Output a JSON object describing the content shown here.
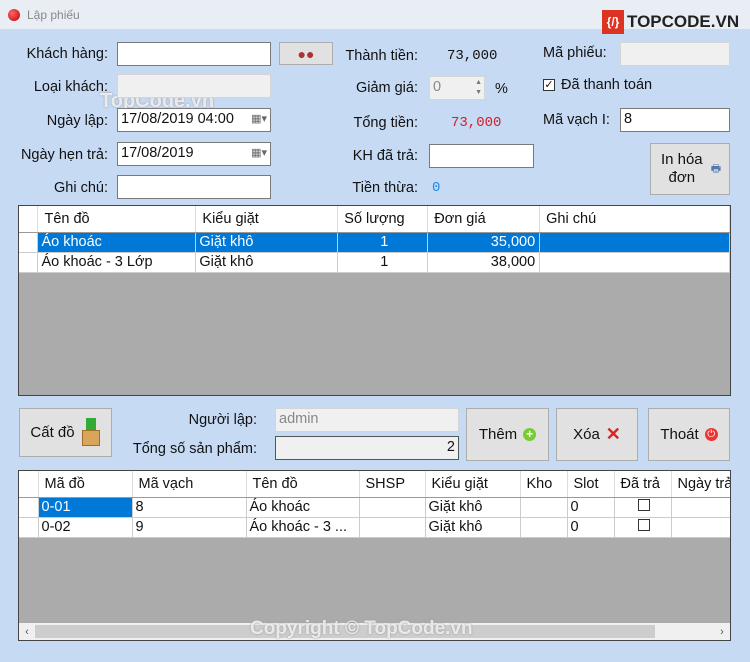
{
  "window": {
    "title": "Lập phiếu",
    "logo": "TOPCODE.VN",
    "watermark": "TopCode.vn",
    "copyright": "Copyright © TopCode.vn"
  },
  "form": {
    "khach_hang_label": "Khách hàng:",
    "khach_hang_value": "",
    "loai_khach_label": "Loại khách:",
    "loai_khach_value": "",
    "ngay_lap_label": "Ngày lập:",
    "ngay_lap_value": "17/08/2019 04:00",
    "ngay_hen_tra_label": "Ngày hẹn trả:",
    "ngay_hen_tra_value": "17/08/2019",
    "ghi_chu_label": "Ghi chú:",
    "ghi_chu_value": "",
    "thanh_tien_label": "Thành tiền:",
    "thanh_tien_value": "73,000",
    "giam_gia_label": "Giảm giá:",
    "giam_gia_value": "0",
    "percent": "%",
    "tong_tien_label": "Tổng tiền:",
    "tong_tien_value": "73,000",
    "kh_da_tra_label": "KH đã trả:",
    "kh_da_tra_value": "",
    "tien_thua_label": "Tiền thừa:",
    "tien_thua_value": "0",
    "ma_phieu_label": "Mã phiếu:",
    "ma_phieu_value": "",
    "da_thanh_toan_label": "Đã thanh toán",
    "da_thanh_toan_checked": true,
    "ma_vach_label": "Mã vạch I:",
    "ma_vach_value": "8",
    "in_hoa_don_label": "In hóa đơn"
  },
  "colors": {
    "tong_tien": "#d0202a",
    "tien_thua": "#1e88e5",
    "selection": "#0078d7"
  },
  "items_grid": {
    "columns": [
      "Tên đồ",
      "Kiểu giặt",
      "Số lượng",
      "Đơn giá",
      "Ghi chú"
    ],
    "rows": [
      [
        "Áo khoác",
        "Giặt khô",
        "1",
        "35,000",
        ""
      ],
      [
        "Áo khoác - 3 Lớp",
        "Giặt khô",
        "1",
        "38,000",
        ""
      ]
    ]
  },
  "middle": {
    "cat_do_label": "Cất đồ",
    "nguoi_lap_label": "Người lập:",
    "nguoi_lap_value": "admin",
    "tong_sp_label": "Tổng số sản phẩm:",
    "tong_sp_value": "2",
    "them_label": "Thêm",
    "xoa_label": "Xóa",
    "thoat_label": "Thoát"
  },
  "products_grid": {
    "columns": [
      "Mã đồ",
      "Mã vạch",
      "Tên đồ",
      "SHSP",
      "Kiểu giặt",
      "Kho",
      "Slot",
      "Đã trả",
      "Ngày trả"
    ],
    "rows": [
      [
        "0-01",
        "8",
        "Áo khoác",
        "",
        "Giặt khô",
        "",
        "0",
        "",
        ""
      ],
      [
        "0-02",
        "9",
        "Áo khoác - 3 ...",
        "",
        "Giặt khô",
        "",
        "0",
        "",
        ""
      ]
    ]
  }
}
